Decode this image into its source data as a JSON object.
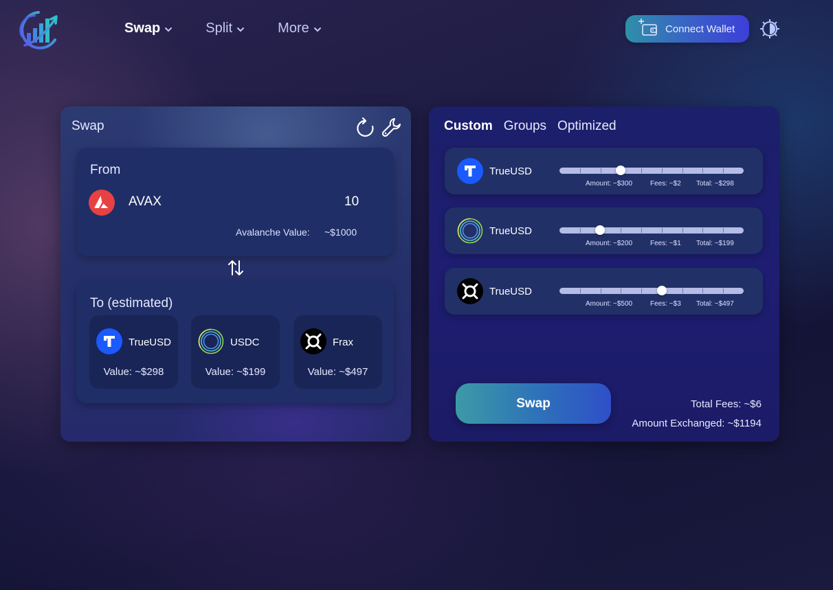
{
  "colors": {
    "accent_teal": "#2f8fa8",
    "accent_blue": "#3d3fd8",
    "avax_red": "#e84142",
    "trueusd_blue": "#1a5aff",
    "usdc_teal": "#3fa9c9",
    "frax_black": "#000000"
  },
  "header": {
    "nav": [
      {
        "label": "Swap",
        "active": true
      },
      {
        "label": "Split",
        "active": false
      },
      {
        "label": "More",
        "active": false
      }
    ],
    "connect_wallet": "Connect Wallet",
    "icons": [
      "logo-icon",
      "wallet-icon",
      "settings-icon"
    ]
  },
  "swap_panel": {
    "title": "Swap",
    "from": {
      "label": "From",
      "token": "AVAX",
      "amount": "10",
      "value_label": "Avalanche Value:",
      "value": "~$1000"
    },
    "to": {
      "label": "To (estimated)",
      "tokens": [
        {
          "name": "TrueUSD",
          "value": "Value: ~$298",
          "icon": "trueusd-icon"
        },
        {
          "name": "USDC",
          "value": "Value: ~$199",
          "icon": "usdc-icon"
        },
        {
          "name": "Frax",
          "value": "Value: ~$497",
          "icon": "frax-icon"
        }
      ]
    }
  },
  "allocation_panel": {
    "tabs": [
      {
        "label": "Custom",
        "active": true
      },
      {
        "label": "Groups",
        "active": false
      },
      {
        "label": "Optimized",
        "active": false
      }
    ],
    "rows": [
      {
        "name": "TrueUSD",
        "icon": "trueusd-icon",
        "slider_fraction": 0.333,
        "amount": "Amount: ~$300",
        "fees": "Fees: ~$2",
        "total": "Total: ~$298"
      },
      {
        "name": "TrueUSD",
        "icon": "usdc-icon",
        "slider_fraction": 0.222,
        "amount": "Amount: ~$200",
        "fees": "Fees: ~$1",
        "total": "Total: ~$199"
      },
      {
        "name": "TrueUSD",
        "icon": "frax-icon",
        "slider_fraction": 0.555,
        "amount": "Amount: ~$500",
        "fees": "Fees: ~$3",
        "total": "Total: ~$497"
      }
    ],
    "swap_button": "Swap",
    "total_fees": "Total Fees: ~$6",
    "amount_exchanged": "Amount Exchanged: ~$1194"
  }
}
